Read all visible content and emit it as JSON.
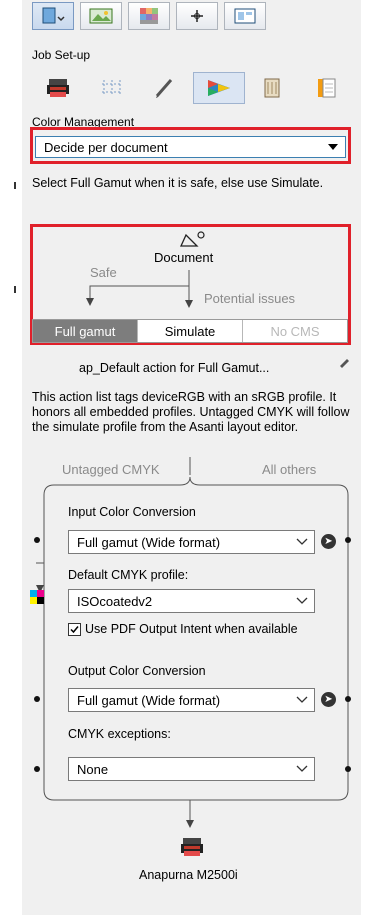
{
  "header": {
    "title": "Job Set-up"
  },
  "color_management": {
    "section_label": "Color Management",
    "mode_value": "Decide per document",
    "hint": "Select Full Gamut when it is safe, else use Simulate."
  },
  "decision": {
    "document_label": "Document",
    "safe_label": "Safe",
    "issues_label": "Potential issues",
    "options": [
      "Full gamut",
      "Simulate",
      "No CMS"
    ]
  },
  "action": {
    "name": "ap_Default action for Full Gamut...",
    "description": "This action list tags deviceRGB with an sRGB profile. It honors all embedded profiles. Untagged CMYK will follow the simulate profile from the Asanti layout editor."
  },
  "flow": {
    "branch_left": "Untagged CMYK",
    "branch_right": "All others",
    "input_conversion_label": "Input Color Conversion",
    "input_conversion_value": "Full gamut (Wide format)",
    "default_cmyk_label": "Default CMYK profile:",
    "default_cmyk_value": "ISOcoatedv2",
    "output_intent_label": "Use PDF Output Intent when available",
    "output_conversion_label": "Output Color Conversion",
    "output_conversion_value": "Full gamut (Wide format)",
    "cmyk_exceptions_label": "CMYK exceptions:",
    "cmyk_exceptions_value": "None"
  },
  "printer": {
    "name": "Anapurna M2500i"
  }
}
